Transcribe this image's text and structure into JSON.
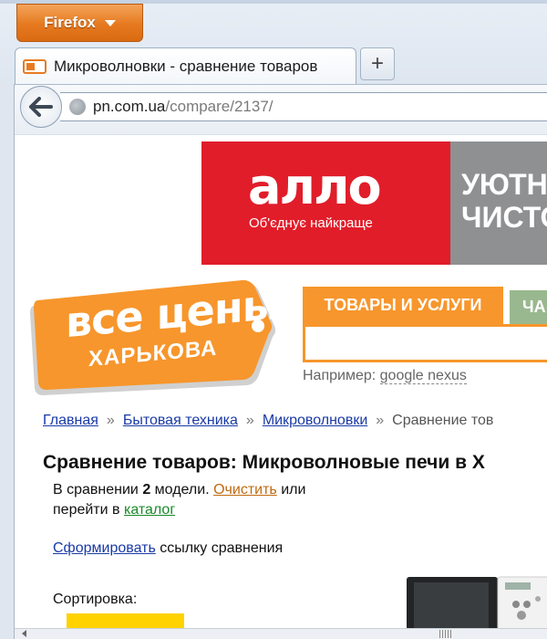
{
  "browser": {
    "menu_button": "Firefox",
    "tab_title": "Микроволновки - сравнение товаров",
    "new_tab": "+",
    "url_host": "pn.com.ua",
    "url_path": "/compare/2137/"
  },
  "ad": {
    "logo": "алло",
    "slogan": "Об'єднує найкраще",
    "right_line1": "УЮТН",
    "right_line2": "ЧИСТО"
  },
  "site": {
    "logo_line1": "все цены",
    "logo_line2": "ХАРЬКОВА",
    "tab_products": "ТОВАРЫ И УСЛУГИ",
    "tab_other": "ЧА",
    "search_hint_prefix": "Например:",
    "search_hint_example": "google nexus"
  },
  "breadcrumb": {
    "items": [
      "Главная",
      "Бытовая техника",
      "Микроволновки"
    ],
    "current": "Сравнение тов",
    "separator": "»"
  },
  "content": {
    "title": "Сравнение товаров: Микроволновые печи в Х",
    "compare_prefix": "В сравнении",
    "compare_count": "2",
    "compare_suffix": "модели.",
    "clear_link": "Очистить",
    "or_text": "или",
    "goto_prefix": "перейти в",
    "catalog_link": "каталог",
    "form_link": "Сформировать",
    "form_suffix": "ссылку сравнения",
    "sort_label": "Сортировка:"
  },
  "colors": {
    "firefox_orange": "#e6791f",
    "ad_red": "#e11d2a",
    "site_orange": "#f7962c",
    "link_blue": "#1a3aa6",
    "link_green": "#1a8a2a",
    "link_orange": "#c06a10"
  }
}
